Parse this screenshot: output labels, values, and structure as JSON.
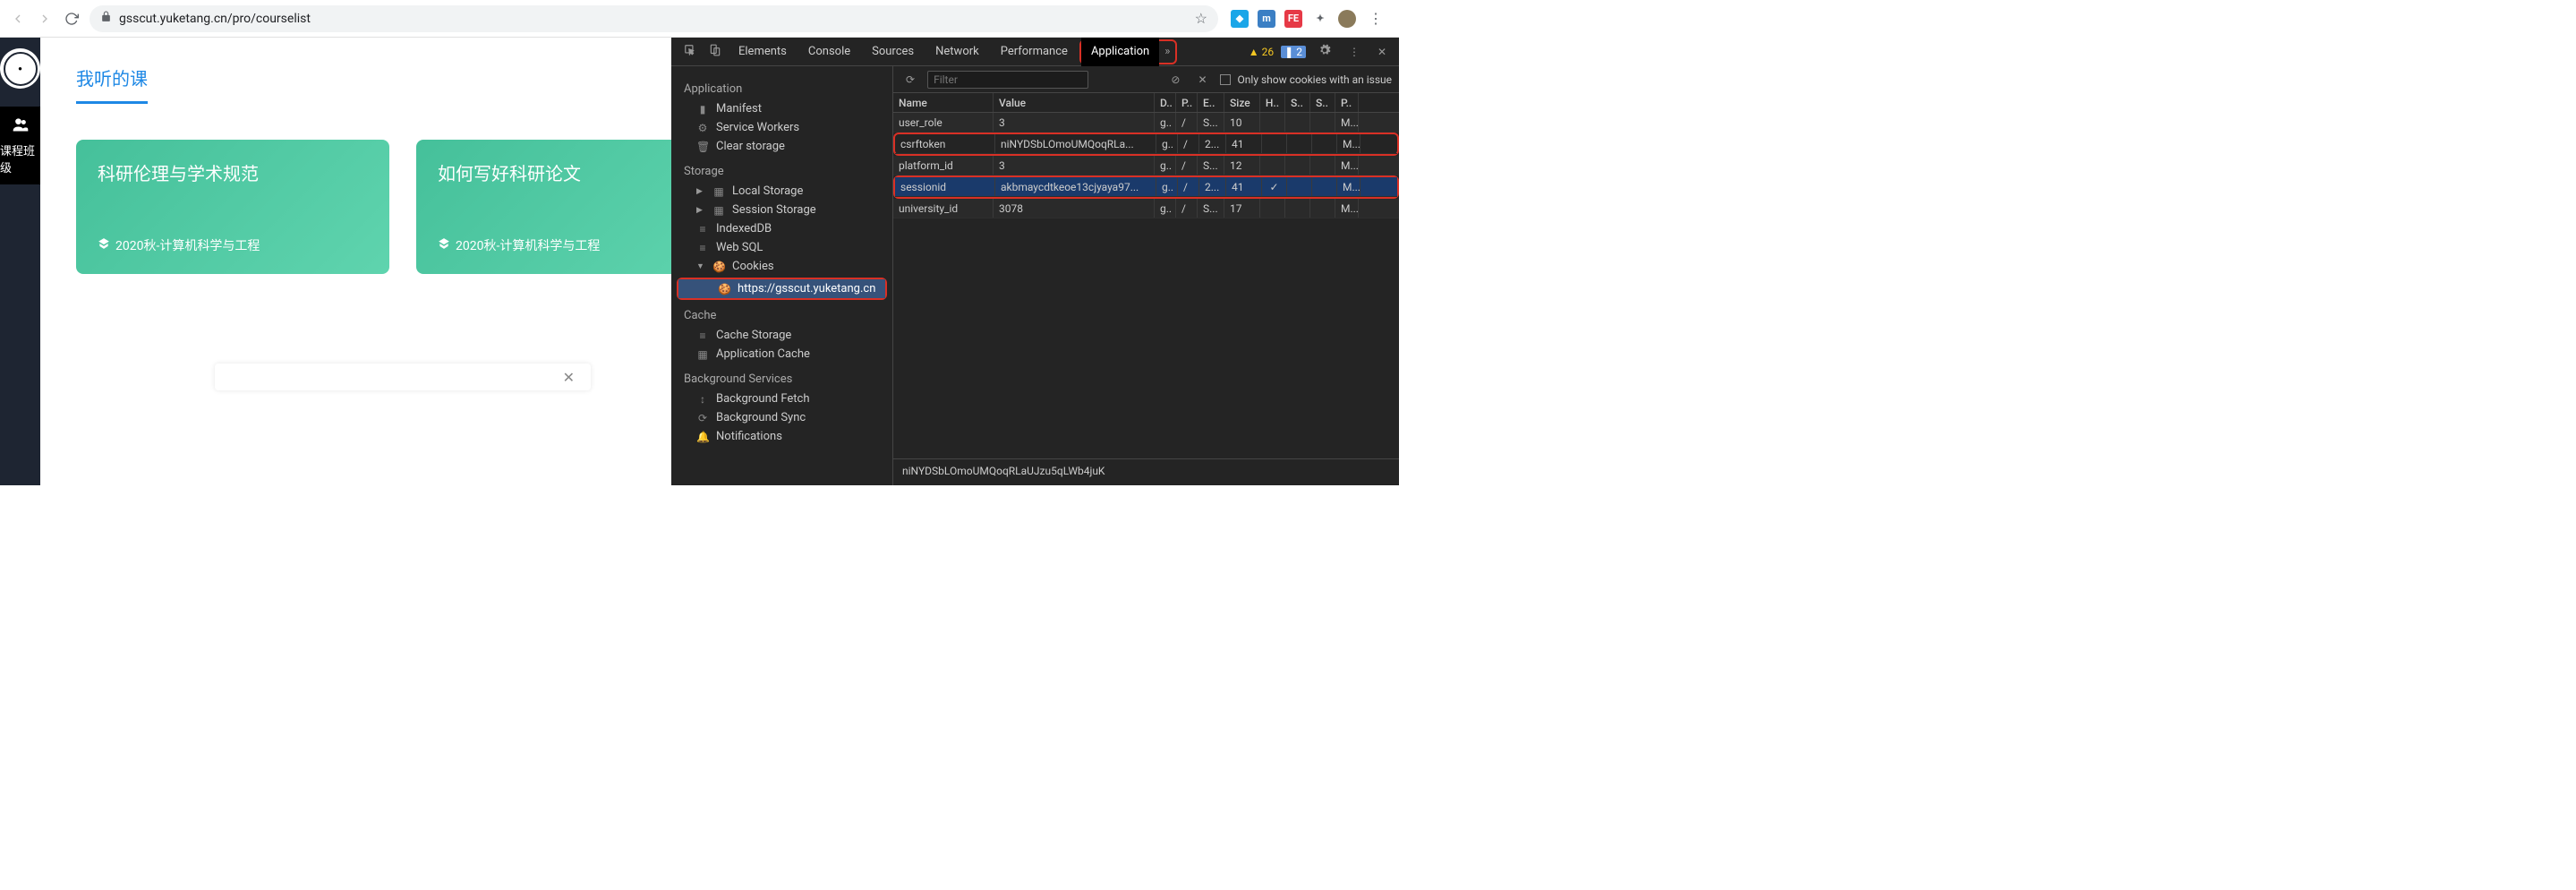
{
  "browser": {
    "url": "gsscut.yuketang.cn/pro/courselist"
  },
  "app": {
    "page_title": "我听的课",
    "sidebar_label": "课程班级",
    "courses": [
      {
        "name": "科研伦理与学术规范",
        "sub": "2020秋-计算机科学与工程"
      },
      {
        "name": "如何写好科研论文",
        "sub": "2020秋-计算机科学与工程"
      }
    ]
  },
  "devtools": {
    "tabs": [
      "Elements",
      "Console",
      "Sources",
      "Network",
      "Performance",
      "Application"
    ],
    "active_tab": "Application",
    "warnings": "26",
    "infos": "2",
    "sidebar": {
      "application": {
        "title": "Application",
        "items": [
          "Manifest",
          "Service Workers",
          "Clear storage"
        ]
      },
      "storage": {
        "title": "Storage",
        "items": [
          "Local Storage",
          "Session Storage",
          "IndexedDB",
          "Web SQL",
          "Cookies"
        ],
        "cookie_origin": "https://gsscut.yuketang.cn"
      },
      "cache": {
        "title": "Cache",
        "items": [
          "Cache Storage",
          "Application Cache"
        ]
      },
      "background": {
        "title": "Background Services",
        "items": [
          "Background Fetch",
          "Background Sync",
          "Notifications"
        ]
      }
    },
    "filter": {
      "placeholder": "Filter",
      "only_issues_label": "Only show cookies with an issue"
    },
    "table": {
      "headers": {
        "name": "Name",
        "value": "Value",
        "d": "D..",
        "p": "P..",
        "e": "E..",
        "size": "Size",
        "h": "H..",
        "s": "S..",
        "ss": "S..",
        "pr": "P.."
      },
      "rows": [
        {
          "name": "user_role",
          "value": "3",
          "d": "g..",
          "p": "/",
          "e": "S...",
          "size": "10",
          "h": "",
          "s": "",
          "ss": "",
          "pr": "M..."
        },
        {
          "name": "csrftoken",
          "value": "niNYDSbLOmoUMQoqRLa...",
          "d": "g..",
          "p": "/",
          "e": "2...",
          "size": "41",
          "h": "",
          "s": "",
          "ss": "",
          "pr": "M..."
        },
        {
          "name": "platform_id",
          "value": "3",
          "d": "g..",
          "p": "/",
          "e": "S...",
          "size": "12",
          "h": "",
          "s": "",
          "ss": "",
          "pr": "M..."
        },
        {
          "name": "sessionid",
          "value": "akbmaycdtkeoe13cjyaya97...",
          "d": "g..",
          "p": "/",
          "e": "2...",
          "size": "41",
          "h": "✓",
          "s": "",
          "ss": "",
          "pr": "M..."
        },
        {
          "name": "university_id",
          "value": "3078",
          "d": "g..",
          "p": "/",
          "e": "S...",
          "size": "17",
          "h": "",
          "s": "",
          "ss": "",
          "pr": "M..."
        }
      ]
    },
    "detail_value": "niNYDSbLOmoUMQoqRLaUJzu5qLWb4juK"
  }
}
